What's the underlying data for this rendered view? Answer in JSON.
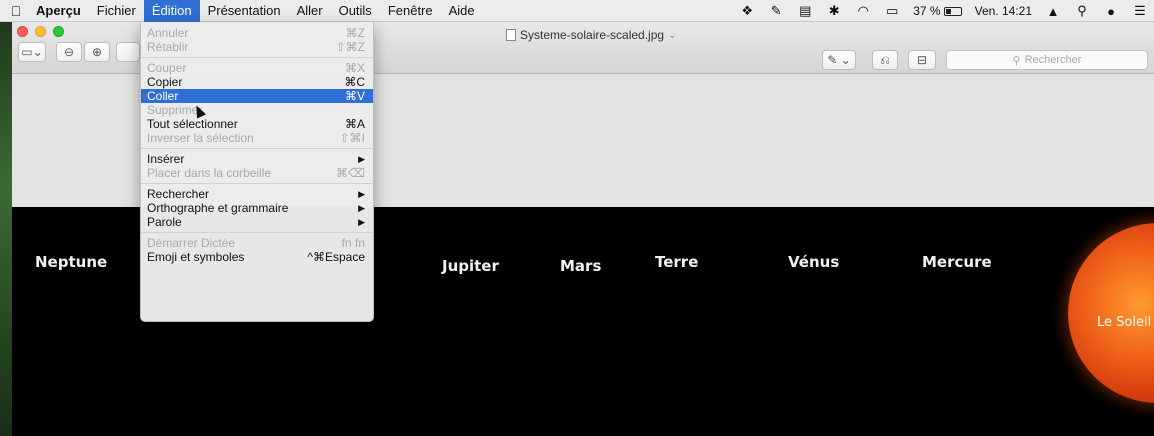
{
  "menubar": {
    "apple": "",
    "items": [
      "Aperçu",
      "Fichier",
      "Édition",
      "Présentation",
      "Aller",
      "Outils",
      "Fenêtre",
      "Aide"
    ],
    "active_index": 2,
    "status": {
      "battery": "37 %",
      "battery_level": 0.37,
      "clock": "Ven. 14:21"
    }
  },
  "window": {
    "document_title": "Systeme-solaire-scaled.jpg",
    "search_placeholder": "Rechercher"
  },
  "edit_menu": {
    "groups": [
      [
        {
          "label": "Annuler",
          "shortcut": "⌘Z",
          "enabled": false
        },
        {
          "label": "Rétablir",
          "shortcut": "⇧⌘Z",
          "enabled": false
        }
      ],
      [
        {
          "label": "Couper",
          "shortcut": "⌘X",
          "enabled": false
        },
        {
          "label": "Copier",
          "shortcut": "⌘C",
          "enabled": true
        },
        {
          "label": "Coller",
          "shortcut": "⌘V",
          "enabled": true,
          "selected": true
        },
        {
          "label": "Supprimer",
          "shortcut": "",
          "enabled": false
        },
        {
          "label": "Tout sélectionner",
          "shortcut": "⌘A",
          "enabled": true
        },
        {
          "label": "Inverser la sélection",
          "shortcut": "⇧⌘I",
          "enabled": false
        }
      ],
      [
        {
          "label": "Insérer",
          "shortcut": "▶",
          "enabled": true
        },
        {
          "label": "Placer dans la corbeille",
          "shortcut": "⌘⌫",
          "enabled": false
        }
      ],
      [
        {
          "label": "Rechercher",
          "shortcut": "▶",
          "enabled": true
        },
        {
          "label": "Orthographe et grammaire",
          "shortcut": "▶",
          "enabled": true
        },
        {
          "label": "Parole",
          "shortcut": "▶",
          "enabled": true
        }
      ],
      [
        {
          "label": "Démarrer Dictée",
          "shortcut": "fn fn",
          "enabled": false
        },
        {
          "label": "Emoji et symboles",
          "shortcut": "^⌘Espace",
          "enabled": true
        }
      ]
    ]
  },
  "image": {
    "planets": [
      "Neptune",
      "Jupiter",
      "Mars",
      "Terre",
      "Vénus",
      "Mercure"
    ],
    "sun_label": "Le Soleil"
  }
}
